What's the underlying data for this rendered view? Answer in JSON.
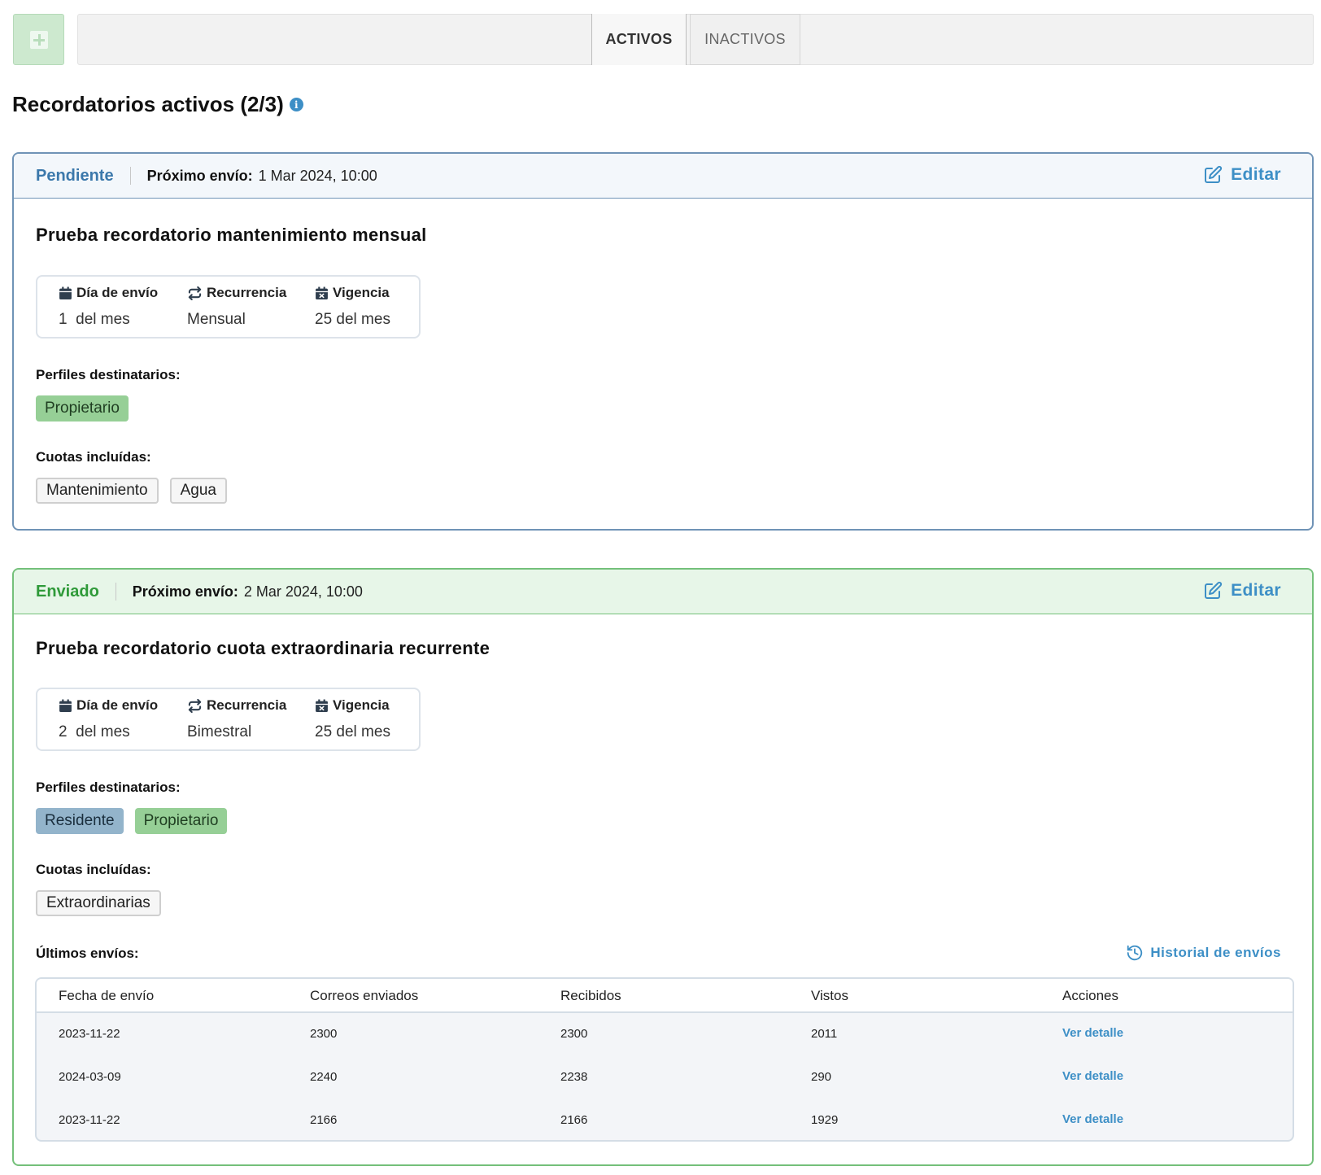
{
  "topbar": {
    "add_icon": "plus-square-icon",
    "tabs": [
      {
        "label": "ACTIVOS",
        "active": true
      },
      {
        "label": "INACTIVOS",
        "active": false
      }
    ]
  },
  "page": {
    "title": "Recordatorios activos (2/3)",
    "info_icon_glyph": "i"
  },
  "colors": {
    "accent": "#3d8fc6",
    "pending": "#3b78ab",
    "sent": "#2f9a39",
    "tag_propietario": "#96cf96",
    "tag_residente": "#93b4cb"
  },
  "reminders": [
    {
      "status": "Pendiente",
      "next_label": "Próximo envío:",
      "next_value": "1 Mar 2024, 10:00",
      "edit_label": "Editar",
      "title": "Prueba recordatorio mantenimiento mensual",
      "info": {
        "send_day_label": "Día de envío",
        "send_day_value": "1  del mes",
        "recurrence_label": "Recurrencia",
        "recurrence_value": "Mensual",
        "validity_label": "Vigencia",
        "validity_value": "25 del mes"
      },
      "profiles_label": "Perfiles destinatarios:",
      "profiles": [
        "Propietario"
      ],
      "fees_label": "Cuotas incluídas:",
      "fees": [
        "Mantenimiento",
        "Agua"
      ]
    },
    {
      "status": "Enviado",
      "next_label": "Próximo envío:",
      "next_value": "2 Mar 2024, 10:00",
      "edit_label": "Editar",
      "title": "Prueba recordatorio cuota extraordinaria recurrente",
      "info": {
        "send_day_label": "Día de envío",
        "send_day_value": "2  del mes",
        "recurrence_label": "Recurrencia",
        "recurrence_value": "Bimestral",
        "validity_label": "Vigencia",
        "validity_value": "25 del mes"
      },
      "profiles_label": "Perfiles destinatarios:",
      "profiles": [
        "Residente",
        "Propietario"
      ],
      "fees_label": "Cuotas incluídas:",
      "fees": [
        "Extraordinarias"
      ],
      "last_sends_label": "Últimos envíos:",
      "history_label": "Historial de envíos",
      "table": {
        "columns": [
          "Fecha de envío",
          "Correos enviados",
          "Recibidos",
          "Vistos",
          "Acciones"
        ],
        "rows": [
          [
            "2023-11-22",
            "2300",
            "2300",
            "2011",
            "Ver detalle"
          ],
          [
            "2024-03-09",
            "2240",
            "2238",
            "290",
            "Ver detalle"
          ],
          [
            "2023-11-22",
            "2166",
            "2166",
            "1929",
            "Ver detalle"
          ]
        ]
      }
    }
  ]
}
